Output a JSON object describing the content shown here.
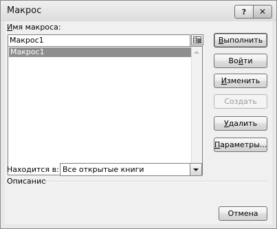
{
  "window": {
    "title": "Макрос",
    "help_glyph": "?",
    "close_glyph": "✕"
  },
  "macro_name": {
    "label_u": "И",
    "label_rest": "мя макроса:",
    "value": "Макрос1"
  },
  "macro_list": {
    "items": [
      "Макрос1"
    ],
    "selected": "Макрос1"
  },
  "buttons": {
    "run": {
      "pre": "",
      "u": "В",
      "post": "ыполнить"
    },
    "step_into": {
      "pre": "Во",
      "u": "й",
      "post": "ти"
    },
    "edit": {
      "pre": "",
      "u": "И",
      "post": "зменить"
    },
    "create": {
      "pre": "",
      "u": "С",
      "post": "оздать"
    },
    "delete": {
      "pre": "",
      "u": "У",
      "post": "далить"
    },
    "options": {
      "pre": "",
      "u": "П",
      "post": "араметры..."
    },
    "cancel": "Отмена"
  },
  "location": {
    "label_pre": "Нахо",
    "label_u": "д",
    "label_post": "ится в:",
    "value": "Все открытые книги"
  },
  "description": {
    "label": "Описание"
  }
}
